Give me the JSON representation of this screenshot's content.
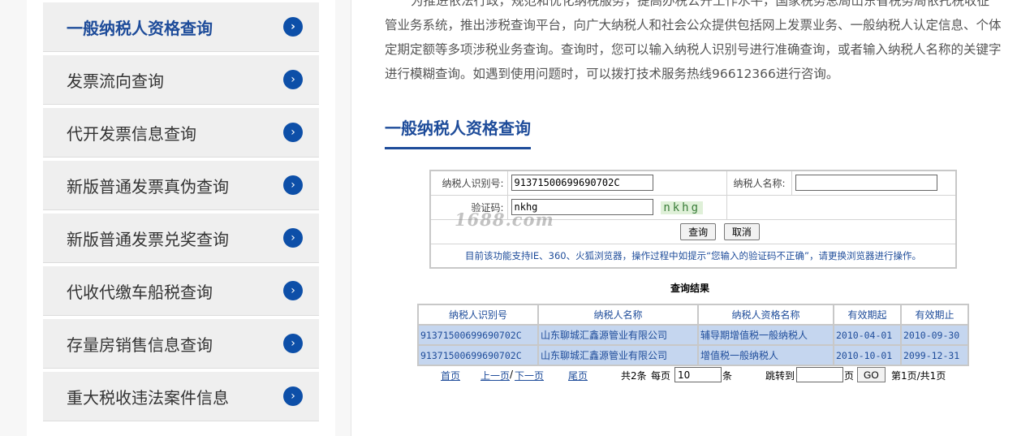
{
  "sidebar": {
    "items": [
      {
        "label": "一般纳税人资格查询"
      },
      {
        "label": "发票流向查询"
      },
      {
        "label": "代开发票信息查询"
      },
      {
        "label": "新版普通发票真伪查询"
      },
      {
        "label": "新版普通发票兑奖查询"
      },
      {
        "label": "代收代缴车船税查询"
      },
      {
        "label": "存量房销售信息查询"
      },
      {
        "label": "重大税收违法案件信息"
      }
    ],
    "arrow_glyph": "›"
  },
  "intro": {
    "text": "为推进依法行政，规范和优化纳税服务，提高办税公开工作水平，国家税务总局山东省税务局依托税收征管业务系统，推出涉税查询平台，向广大纳税人和社会公众提供包括网上发票业务、一般纳税人认定信息、个体定期定额等多项涉税业务查询。查询时，您可以输入纳税人识别号进行准确查询，或者输入纳税人名称的关键字进行模糊查询。如遇到使用问题时，可以拨打技术服务热线96612366进行咨询。"
  },
  "section_title": "一般纳税人资格查询",
  "form": {
    "taxpayer_id_label": "纳税人识别号:",
    "taxpayer_id_value": "91371500699690702C",
    "taxpayer_name_label": "纳税人名称:",
    "taxpayer_name_value": "",
    "captcha_label": "验证码:",
    "captcha_value": "nkhg",
    "captcha_image_text": "nkhg",
    "query_button": "查询",
    "cancel_button": "取消",
    "notice": "目前该功能支持IE、360、火狐浏览器，操作过程中如提示“您输入的验证码不正确”，请更换浏览器进行操作。"
  },
  "watermark": "1688.com",
  "results": {
    "title": "查询结果",
    "headers": [
      "纳税人识别号",
      "纳税人名称",
      "纳税人资格名称",
      "有效期起",
      "有效期止"
    ],
    "rows": [
      [
        "91371500699690702C",
        "山东聊城汇鑫源管业有限公司",
        "辅导期增值税一般纳税人",
        "2010-04-01",
        "2010-09-30"
      ],
      [
        "91371500699690702C",
        "山东聊城汇鑫源管业有限公司",
        "增值税一般纳税人",
        "2010-10-01",
        "2099-12-31"
      ]
    ]
  },
  "pager": {
    "first": "首页",
    "prev": "上一页",
    "sep": "/",
    "next": "下一页",
    "last": "尾页",
    "total": "共2条",
    "per_page_label": "每页",
    "per_page_value": "10",
    "per_page_unit": "条",
    "jump_label": "跳转到",
    "jump_value": "",
    "page_unit": "页",
    "go_button": "GO",
    "page_info": "第1页/共1页"
  },
  "colors": {
    "accent": "#1e4c9a",
    "arrow_bg": "#0d4fa8",
    "row_bg": "#c5d6ef"
  }
}
